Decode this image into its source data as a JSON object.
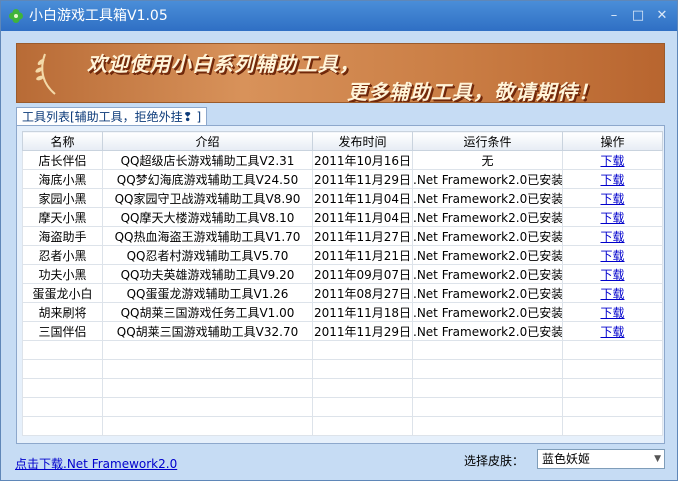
{
  "window": {
    "title": "小白游戏工具箱V1.05",
    "minimize": "–",
    "maximize": "□",
    "close": "✕"
  },
  "banner": {
    "line1": "欢迎使用小白系列辅助工具，",
    "line2": "更多辅助工具，敬请期待！"
  },
  "tab": {
    "label": "工具列表[辅助工具，拒绝外挂❢ ]"
  },
  "table": {
    "headers": [
      "名称",
      "介绍",
      "发布时间",
      "运行条件",
      "操作"
    ],
    "rows": [
      [
        "店长伴侣",
        "QQ超级店长游戏辅助工具V2.31",
        "2011年10月16日",
        "无",
        "下载"
      ],
      [
        "海底小黑",
        "QQ梦幻海底游戏辅助工具V24.50",
        "2011年11月29日",
        ".Net Framework2.0已安装",
        "下载"
      ],
      [
        "家园小黑",
        "QQ家园守卫战游戏辅助工具V8.90",
        "2011年11月04日",
        ".Net Framework2.0已安装",
        "下载"
      ],
      [
        "摩天小黑",
        "QQ摩天大楼游戏辅助工具V8.10",
        "2011年11月04日",
        ".Net Framework2.0已安装",
        "下载"
      ],
      [
        "海盗助手",
        "QQ热血海盗王游戏辅助工具V1.70",
        "2011年11月27日",
        ".Net Framework2.0已安装",
        "下载"
      ],
      [
        "忍者小黑",
        "QQ忍者村游戏辅助工具V5.70",
        "2011年11月21日",
        ".Net Framework2.0已安装",
        "下载"
      ],
      [
        "功夫小黑",
        "QQ功夫英雄游戏辅助工具V9.20",
        "2011年09月07日",
        ".Net Framework2.0已安装",
        "下载"
      ],
      [
        "蛋蛋龙小白",
        "QQ蛋蛋龙游戏辅助工具V1.26",
        "2011年08月27日",
        ".Net Framework2.0已安装",
        "下载"
      ],
      [
        "胡来刷将",
        "QQ胡莱三国游戏任务工具V1.00",
        "2011年11月18日",
        ".Net Framework2.0已安装",
        "下载"
      ],
      [
        "三国伴侣",
        "QQ胡莱三国游戏辅助工具V32.70",
        "2011年11月29日",
        ".Net Framework2.0已安装",
        "下载"
      ]
    ],
    "empty_rows": 5
  },
  "footer": {
    "download_link": "点击下载.Net Framework2.0",
    "skin_label": "选择皮肤：",
    "skin_value": "蓝色妖姬"
  },
  "colors": {
    "titlebar": "#2f6fc4",
    "window_bg": "#c6dcf4",
    "link": "#0000cc"
  }
}
